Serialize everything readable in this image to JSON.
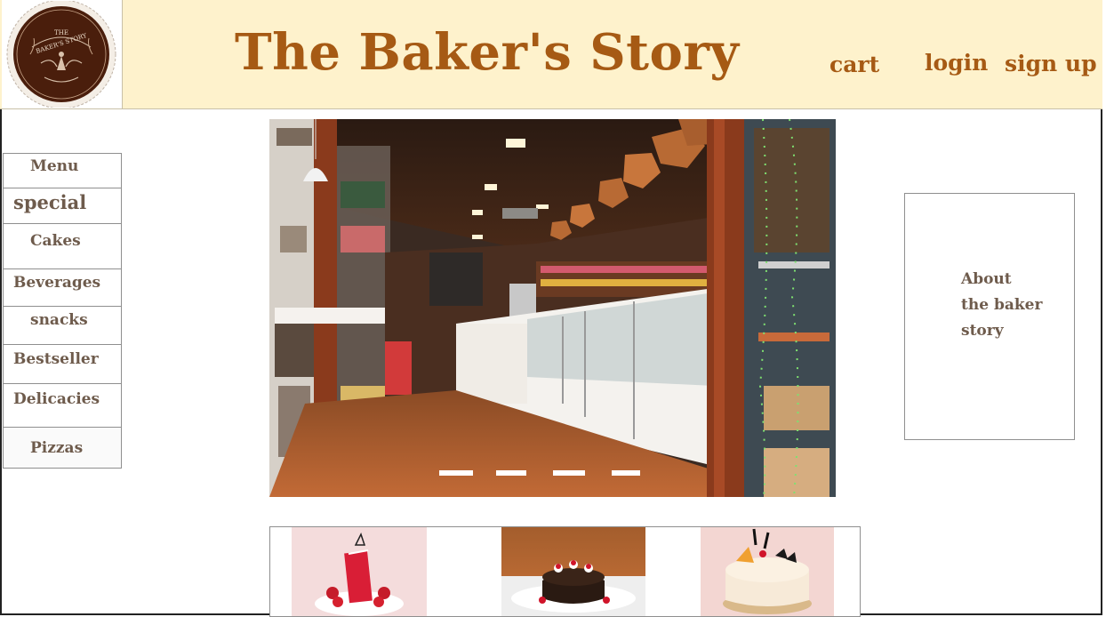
{
  "header": {
    "title": "The Baker's Story",
    "logo_text": [
      "THE",
      "BAKER'S STORY"
    ],
    "nav": {
      "cart": "cart",
      "login": "login",
      "signup": "sign up"
    }
  },
  "sidebar": {
    "items": [
      {
        "label": "Menu"
      },
      {
        "label": "special"
      },
      {
        "label": "Cakes"
      },
      {
        "label": "Beverages"
      },
      {
        "label": "snacks"
      },
      {
        "label": "Bestseller"
      },
      {
        "label": "Delicacies"
      },
      {
        "label": "Pizzas"
      }
    ]
  },
  "hero": {
    "slide_count": 4,
    "active_slide": 1
  },
  "about": {
    "text": "About\nthe baker\nstory"
  },
  "colors": {
    "header_bg": "#fef2cc",
    "brand": "#a65a14",
    "sidebar_text": "#6e5b4c",
    "logo_bg": "#4a1e0c"
  }
}
